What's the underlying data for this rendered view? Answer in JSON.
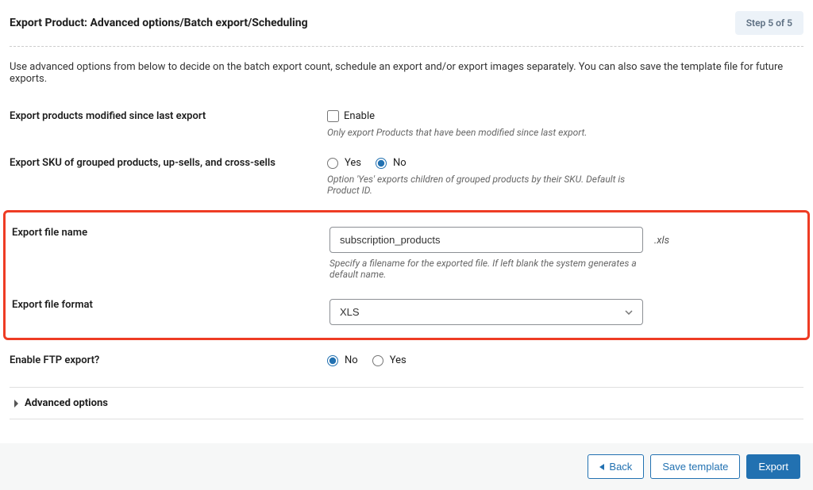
{
  "header": {
    "title": "Export Product: Advanced options/Batch export/Scheduling",
    "step_badge": "Step 5 of 5"
  },
  "intro": "Use advanced options from below to decide on the batch export count, schedule an export and/or export images separately. You can also save the template file for future exports.",
  "fields": {
    "modified_since": {
      "label": "Export products modified since last export",
      "checkbox_label": "Enable",
      "hint": "Only export Products that have been modified since last export."
    },
    "sku_grouped": {
      "label": "Export SKU of grouped products, up-sells, and cross-sells",
      "yes": "Yes",
      "no": "No",
      "selected": "no",
      "hint": "Option 'Yes' exports children of grouped products by their SKU. Default is Product ID."
    },
    "file_name": {
      "label": "Export file name",
      "value": "subscription_products",
      "ext": ".xls",
      "hint": "Specify a filename for the exported file. If left blank the system generates a default name."
    },
    "file_format": {
      "label": "Export file format",
      "value": "XLS"
    },
    "ftp": {
      "label": "Enable FTP export?",
      "no": "No",
      "yes": "Yes",
      "selected": "no"
    }
  },
  "accordion": {
    "advanced_options": "Advanced options"
  },
  "footer": {
    "back": "Back",
    "save_template": "Save template",
    "export": "Export"
  }
}
